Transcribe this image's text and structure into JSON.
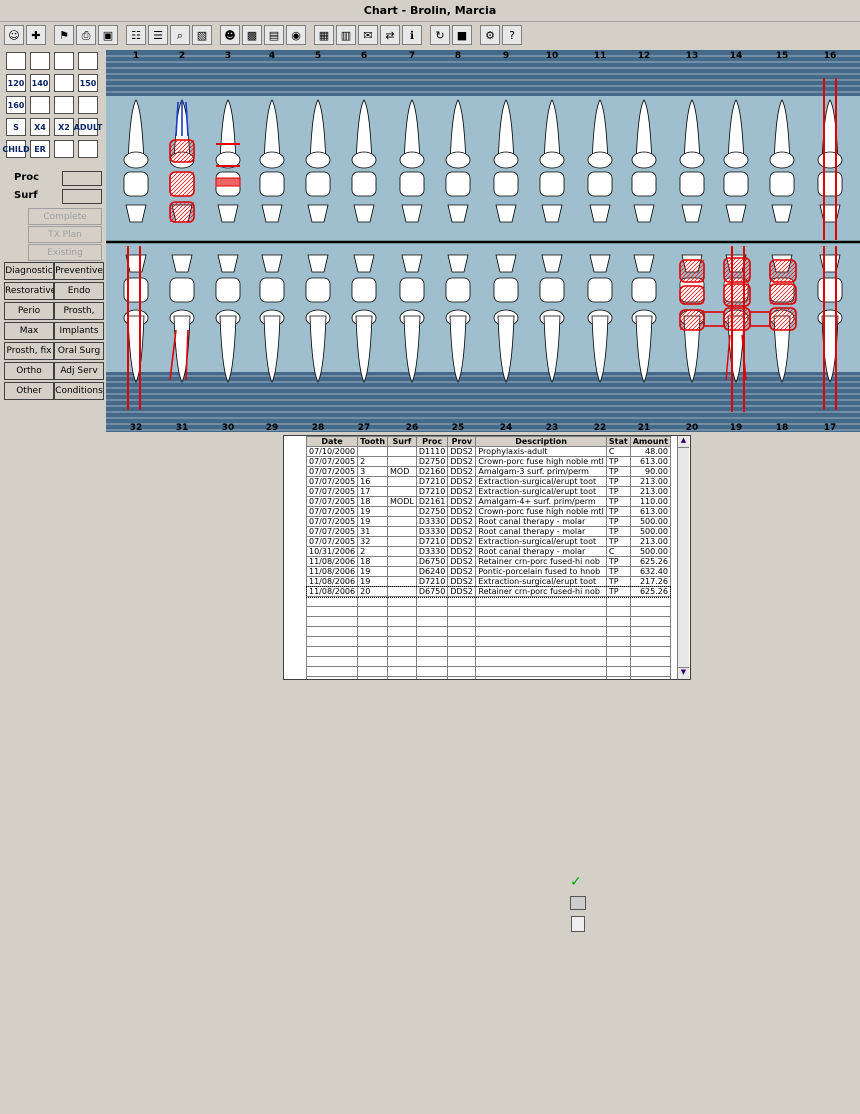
{
  "window": {
    "title": "Chart - Brolin, Marcia"
  },
  "toolbar": {
    "icons": [
      "patient-icon",
      "medical-alert-icon",
      "flag-icon",
      "print-icon",
      "window-icon",
      "teeth-icon",
      "perio-icon",
      "zoom-icon",
      "image-icon",
      "person-icon",
      "xray-icon",
      "scan-icon",
      "camera-icon",
      "chart-icon",
      "compare-icon",
      "letter-icon",
      "transfer-icon",
      "info-icon",
      "refresh-icon",
      "video-icon",
      "gear-icon",
      "help-icon"
    ]
  },
  "left_panel": {
    "proc_label": "Proc",
    "surf_label": "Surf",
    "complete_btn": "Complete",
    "txplan_btn": "TX Plan",
    "existing_btn": "Existing",
    "icon_labels": [
      "120",
      "140",
      "150",
      "160",
      "X4",
      "X2",
      "ADULT",
      "CHILD",
      "ER"
    ],
    "categories": [
      [
        "Diagnostic",
        "Preventive"
      ],
      [
        "Restorative",
        "Endo"
      ],
      [
        "Perio",
        "Prosth, rem"
      ],
      [
        "Max Prosth",
        "Implants"
      ],
      [
        "Prosth, fix",
        "Oral Surg"
      ],
      [
        "Ortho",
        "Adj Serv"
      ],
      [
        "Other",
        "Conditions"
      ]
    ]
  },
  "chart": {
    "upper_numbers": [
      "1",
      "2",
      "3",
      "4",
      "5",
      "6",
      "7",
      "8",
      "9",
      "10",
      "11",
      "12",
      "13",
      "14",
      "15",
      "16"
    ],
    "lower_numbers": [
      "32",
      "31",
      "30",
      "29",
      "28",
      "27",
      "26",
      "25",
      "24",
      "23",
      "22",
      "21",
      "20",
      "19",
      "18",
      "17"
    ]
  },
  "grid": {
    "headers": [
      "Date",
      "Tooth",
      "Surf",
      "Proc",
      "Prov",
      "Description",
      "Stat",
      "Amount"
    ],
    "rows": [
      [
        "07/10/2000",
        "",
        "",
        "D1110",
        "DDS2",
        "Prophylaxis-adult",
        "C",
        "48.00"
      ],
      [
        "07/07/2005",
        "2",
        "",
        "D2750",
        "DDS2",
        "Crown-porc fuse high noble mtl",
        "TP",
        "613.00"
      ],
      [
        "07/07/2005",
        "3",
        "MOD",
        "D2160",
        "DDS2",
        "Amalgam-3 surf. prim/perm",
        "TP",
        "90.00"
      ],
      [
        "07/07/2005",
        "16",
        "",
        "D7210",
        "DDS2",
        "Extraction-surgical/erupt toot",
        "TP",
        "213.00"
      ],
      [
        "07/07/2005",
        "17",
        "",
        "D7210",
        "DDS2",
        "Extraction-surgical/erupt toot",
        "TP",
        "213.00"
      ],
      [
        "07/07/2005",
        "18",
        "MODL",
        "D2161",
        "DDS2",
        "Amalgam-4+ surf. prim/perm",
        "TP",
        "110.00"
      ],
      [
        "07/07/2005",
        "19",
        "",
        "D2750",
        "DDS2",
        "Crown-porc fuse high noble mtl",
        "TP",
        "613.00"
      ],
      [
        "07/07/2005",
        "19",
        "",
        "D3330",
        "DDS2",
        "Root canal therapy - molar",
        "TP",
        "500.00"
      ],
      [
        "07/07/2005",
        "31",
        "",
        "D3330",
        "DDS2",
        "Root canal therapy - molar",
        "TP",
        "500.00"
      ],
      [
        "07/07/2005",
        "32",
        "",
        "D7210",
        "DDS2",
        "Extraction-surgical/erupt toot",
        "TP",
        "213.00"
      ],
      [
        "10/31/2006",
        "2",
        "",
        "D3330",
        "DDS2",
        "Root canal therapy - molar",
        "C",
        "500.00"
      ],
      [
        "11/08/2006",
        "18",
        "",
        "D6750",
        "DDS2",
        "Retainer crn-porc fused-hi nob",
        "TP",
        "625.26"
      ],
      [
        "11/08/2006",
        "19",
        "",
        "D6240",
        "DDS2",
        "Pontic-porcelain fused to hnob",
        "TP",
        "632.40"
      ],
      [
        "11/08/2006",
        "19",
        "",
        "D7210",
        "DDS2",
        "Extraction-surgical/erupt toot",
        "TP",
        "217.26"
      ],
      [
        "11/08/2006",
        "20",
        "",
        "D6750",
        "DDS2",
        "Retainer crn-porc fused-hi nob",
        "TP",
        "625.26"
      ]
    ],
    "empty_rows": 11
  },
  "colors": {
    "chart_bg": "#9fbfcf",
    "band_dark": "#456a89",
    "treatment": "#e00000"
  }
}
